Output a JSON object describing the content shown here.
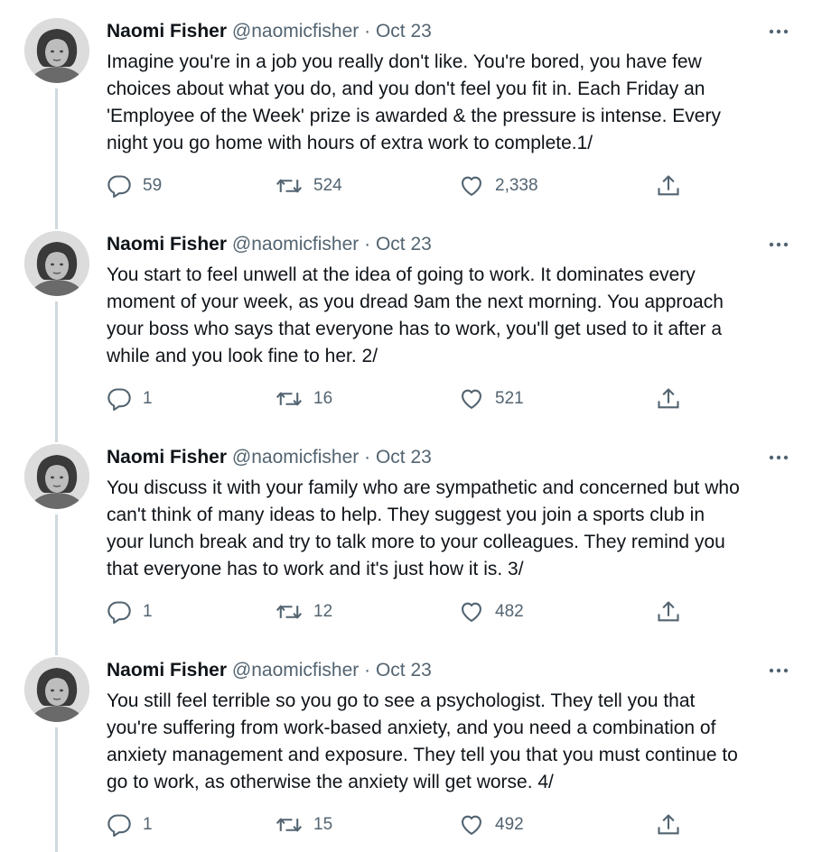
{
  "tweets": [
    {
      "author_name": "Naomi Fisher",
      "handle": "@naomicfisher",
      "separator": "·",
      "date": "Oct 23",
      "text": "Imagine you're in a job you really don't like. You're bored, you have few\nchoices about what you do, and you don't feel you fit in. Each Friday an\n'Employee of the Week' prize is awarded & the pressure is intense. Every\nnight you go home with hours of extra work to complete.1/",
      "replies": "59",
      "retweets": "524",
      "likes": "2,338"
    },
    {
      "author_name": "Naomi Fisher",
      "handle": "@naomicfisher",
      "separator": "·",
      "date": "Oct 23",
      "text": "You start to feel unwell at the idea of going to work.  It dominates every\nmoment of your week, as you dread 9am the next morning.  You approach\nyour boss who says that everyone has to work, you'll get used to it after a\nwhile and you look fine to her. 2/",
      "replies": "1",
      "retweets": "16",
      "likes": "521"
    },
    {
      "author_name": "Naomi Fisher",
      "handle": "@naomicfisher",
      "separator": "·",
      "date": "Oct 23",
      "text": "You discuss it with your family who are sympathetic and concerned but who\ncan't think of many ideas to help. They suggest you join a sports club in\nyour lunch break and try to talk more to your colleagues. They remind you\nthat everyone has to work and it's just how it is. 3/",
      "replies": "1",
      "retweets": "12",
      "likes": "482"
    },
    {
      "author_name": "Naomi Fisher",
      "handle": "@naomicfisher",
      "separator": "·",
      "date": "Oct 23",
      "text": "You still feel terrible so you go to see a psychologist. They tell you that\nyou're suffering from work-based anxiety, and you need a combination of\nanxiety management and exposure.  They tell you that you must continue to\ngo to work, as otherwise the anxiety will get worse. 4/",
      "replies": "1",
      "retweets": "15",
      "likes": "492"
    }
  ],
  "icons": {
    "reply": "reply-icon",
    "retweet": "retweet-icon",
    "like": "heart-icon",
    "share": "share-icon",
    "more": "more-icon"
  },
  "colors": {
    "text": "#0f1419",
    "secondary": "#536471",
    "thread_line": "#cfd9de",
    "background": "#ffffff"
  }
}
